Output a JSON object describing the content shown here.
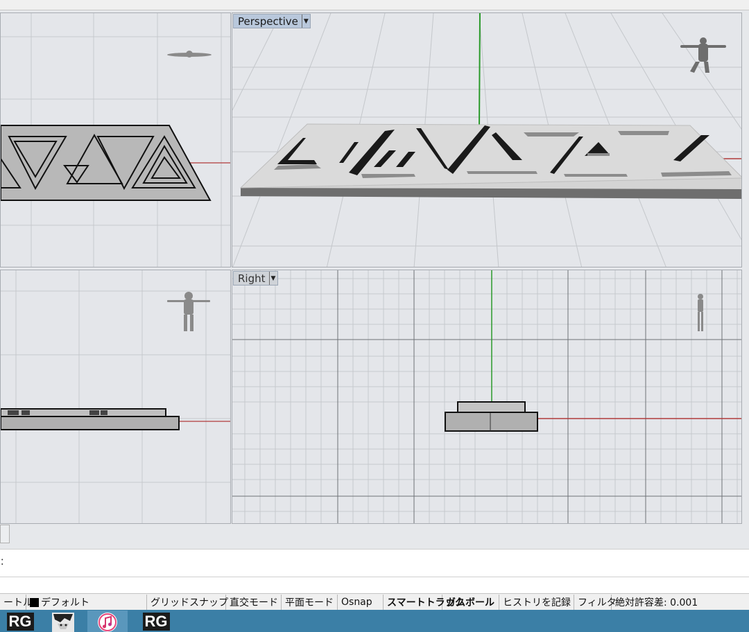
{
  "viewports": {
    "perspective": {
      "label": "Perspective"
    },
    "right": {
      "label": "Right"
    }
  },
  "command": {
    "prompt": "："
  },
  "statusbar": {
    "layer_prefix": "ートル",
    "layer_name": "デフォルト",
    "grid_snap": "グリッドスナップ",
    "ortho": "直交モード",
    "planar": "平面モード",
    "osnap": "Osnap",
    "smarttrack": "スマートトラック",
    "gumball": "ガムボール",
    "history": "ヒストリを記録",
    "filter": "フィルタ",
    "tolerance": "絶対許容差: 0.001"
  },
  "taskbar": {
    "items": [
      {
        "label": "RG",
        "icon": "rhino-app-icon",
        "active": false
      },
      {
        "label": "",
        "icon": "anime-character-icon",
        "active": false
      },
      {
        "label": "",
        "icon": "itunes-icon",
        "active": true
      },
      {
        "label": "RG",
        "icon": "rhino-app-icon",
        "active": false
      }
    ]
  },
  "colors": {
    "x_axis": "#b03a3a",
    "y_axis": "#2a9a2a",
    "viewport_bg": "#e4e6ea",
    "active_label": "#b9c8dc",
    "taskbar": "#3b7fa6"
  }
}
